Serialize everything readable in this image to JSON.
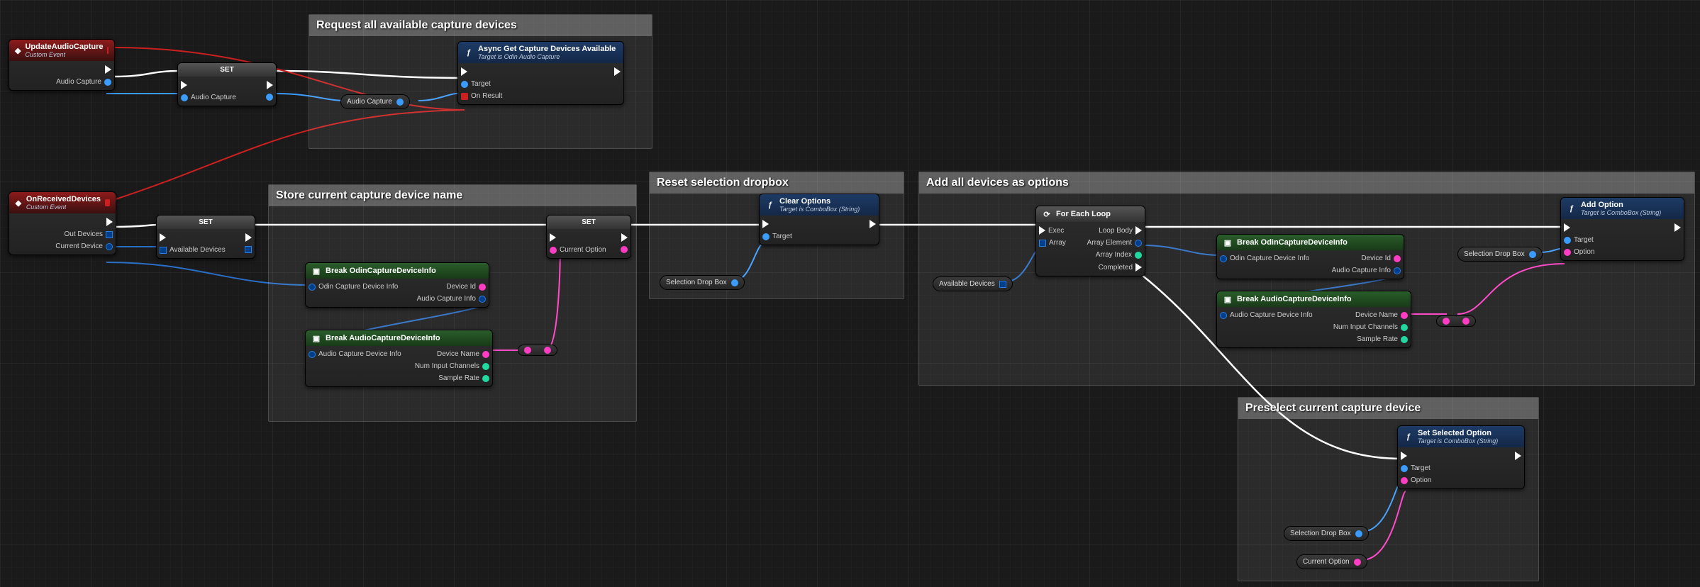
{
  "comments": {
    "request_devices": "Request all available capture devices",
    "store_device": "Store current capture device name",
    "reset_dropbox": "Reset selection dropbox",
    "add_options": "Add all devices as options",
    "preselect": "Preselect current capture device"
  },
  "events": {
    "update_audio": {
      "name": "UpdateAudioCapture",
      "sub": "Custom Event"
    },
    "on_received": {
      "name": "OnReceivedDevices",
      "sub": "Custom Event"
    }
  },
  "nodes": {
    "set1": {
      "title": "SET",
      "pin_out": "Audio Capture"
    },
    "set2": {
      "title": "SET",
      "pin_out": "Available Devices"
    },
    "set3": {
      "title": "SET",
      "pin_out": "Current Option"
    },
    "async_get": {
      "title": "Async Get Capture Devices Available",
      "sub": "Target is Odin Audio Capture",
      "target": "Target",
      "on_result": "On Result"
    },
    "clear_opts": {
      "title": "Clear Options",
      "sub": "Target is ComboBox (String)",
      "target": "Target"
    },
    "foreach": {
      "title": "For Each Loop",
      "exec": "Exec",
      "array": "Array",
      "body": "Loop Body",
      "elem": "Array Element",
      "idx": "Array Index",
      "done": "Completed"
    },
    "break_odin1": {
      "title": "Break OdinCaptureDeviceInfo",
      "in": "Odin Capture Device Info",
      "out_id": "Device Id",
      "out_info": "Audio Capture Info"
    },
    "break_audio1": {
      "title": "Break AudioCaptureDeviceInfo",
      "in": "Audio Capture Device Info",
      "out_name": "Device Name",
      "out_ch": "Num Input Channels",
      "out_rate": "Sample Rate"
    },
    "break_odin2": {
      "title": "Break OdinCaptureDeviceInfo",
      "in": "Odin Capture Device Info",
      "out_id": "Device Id",
      "out_info": "Audio Capture Info"
    },
    "break_audio2": {
      "title": "Break AudioCaptureDeviceInfo",
      "in": "Audio Capture Device Info",
      "out_name": "Device Name",
      "out_ch": "Num Input Channels",
      "out_rate": "Sample Rate"
    },
    "add_option": {
      "title": "Add Option",
      "sub": "Target is ComboBox (String)",
      "target": "Target",
      "option": "Option"
    },
    "set_selected": {
      "title": "Set Selected Option",
      "sub": "Target is ComboBox (String)",
      "target": "Target",
      "option": "Option"
    }
  },
  "vars": {
    "audio_capture": "Audio Capture",
    "selection_drop_box": "Selection Drop Box",
    "available_devices": "Available Devices",
    "current_option": "Current Option"
  },
  "event_pins": {
    "audio_capture": "Audio Capture",
    "out_devices": "Out Devices",
    "current_device": "Current Device"
  }
}
